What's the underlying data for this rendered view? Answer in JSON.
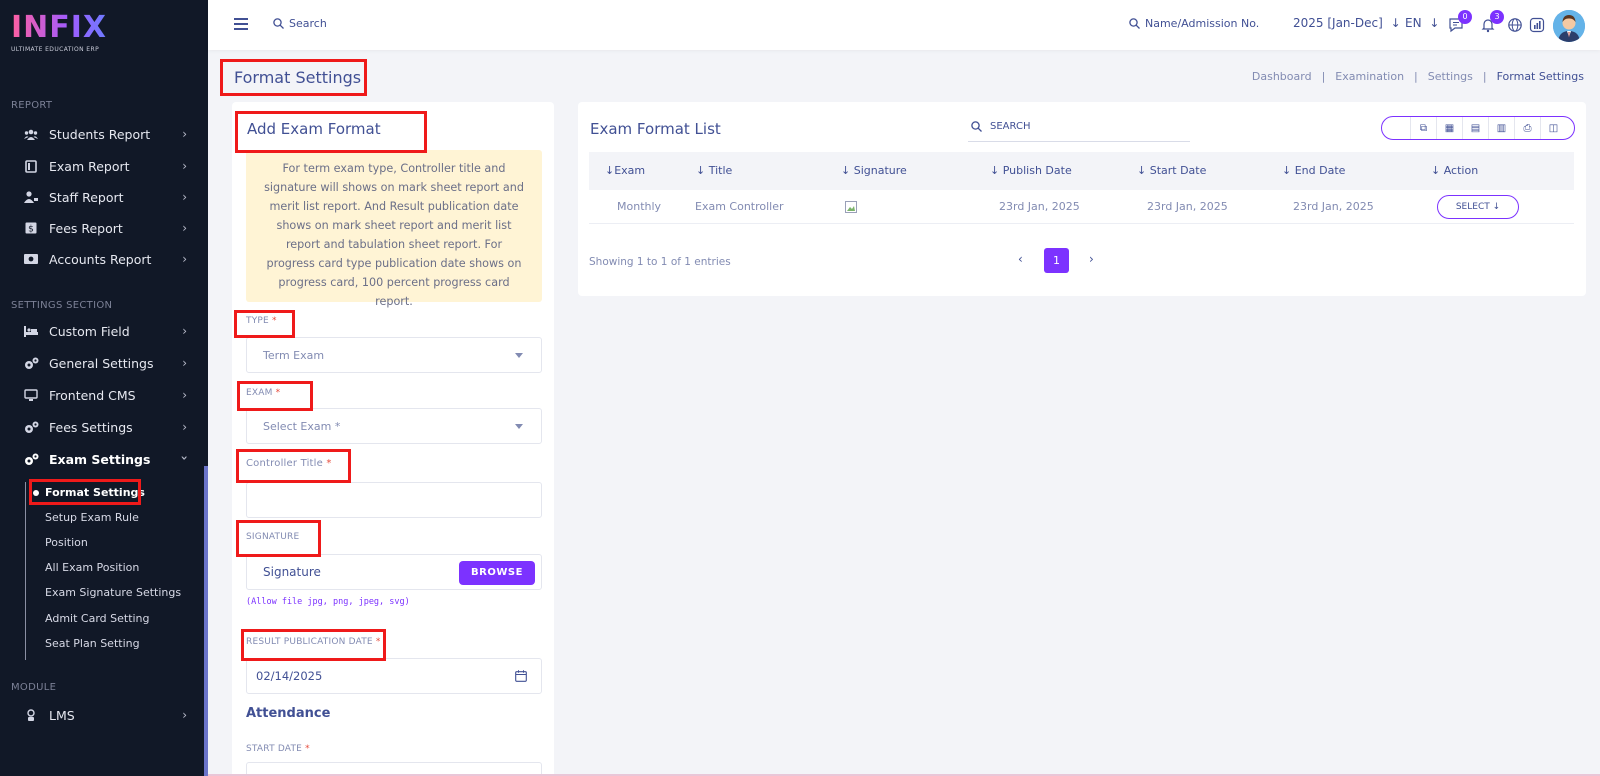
{
  "sidebar": {
    "logo": "INFIX",
    "logo_sub": "ULTIMATE EDUCATION ERP",
    "section_report": "REPORT",
    "report_items": [
      {
        "label": "Students Report",
        "icon": "users-icon"
      },
      {
        "label": "Exam Report",
        "icon": "book-icon"
      },
      {
        "label": "Staff Report",
        "icon": "staff-icon"
      },
      {
        "label": "Fees Report",
        "icon": "dollar-icon"
      },
      {
        "label": "Accounts Report",
        "icon": "money-icon"
      }
    ],
    "section_settings": "SETTINGS SECTION",
    "settings_items": [
      {
        "label": "Custom Field",
        "icon": "bed-icon"
      },
      {
        "label": "General Settings",
        "icon": "cogs-icon"
      },
      {
        "label": "Frontend CMS",
        "icon": "monitor-icon"
      },
      {
        "label": "Fees Settings",
        "icon": "cogs-icon"
      },
      {
        "label": "Exam Settings",
        "icon": "cogs-icon"
      }
    ],
    "exam_sub_items": [
      "Format Settings",
      "Setup Exam Rule",
      "Position",
      "All Exam Position",
      "Exam Signature Settings",
      "Admit Card Setting",
      "Seat Plan Setting"
    ],
    "section_module": "MODULE",
    "module_items": [
      {
        "label": "LMS",
        "icon": "lms-icon"
      }
    ]
  },
  "topbar": {
    "search_label": "Search",
    "name_search_label": "Name/Admission No.",
    "year_label": "2025 [Jan-Dec]",
    "lang_label": "EN",
    "messages_count": "0",
    "notifications_count": "3"
  },
  "breadcrumb": {
    "page_title": "Format Settings",
    "items": [
      "Dashboard",
      "Examination",
      "Settings",
      "Format Settings"
    ]
  },
  "form": {
    "title": "Add Exam Format",
    "notice": "For term exam type, Controller title and signature will shows on mark sheet report and merit list report. And Result publication date shows on mark sheet report and merit list report and tabulation sheet report. For progress card type publication date shows on progress card, 100 percent progress card report.",
    "type_label": "TYPE",
    "type_value": "Term Exam",
    "exam_label": "EXAM",
    "exam_value": "Select Exam *",
    "controller_label": "Controller Title",
    "controller_value": "",
    "signature_label": "SIGNATURE",
    "signature_placeholder": "Signature",
    "browse_label": "BROWSE",
    "file_hint": "(Allow file jpg, png, jpeg, svg)",
    "result_date_label": "RESULT PUBLICATION DATE",
    "result_date_value": "02/14/2025",
    "attendance_title": "Attendance",
    "start_date_label": "START DATE",
    "required_mark": "*"
  },
  "list": {
    "title": "Exam Format List",
    "search_label": "SEARCH",
    "columns": [
      "Exam",
      "Title",
      "Signature",
      "Publish Date",
      "Start Date",
      "End Date",
      "Action"
    ],
    "rows": [
      {
        "exam": "Monthly",
        "title": "Exam Controller",
        "publish_date": "23rd Jan, 2025",
        "start_date": "23rd Jan, 2025",
        "end_date": "23rd Jan, 2025",
        "action": "SELECT"
      }
    ],
    "showing_text": "Showing 1 to 1 of 1 entries",
    "current_page": "1"
  },
  "colors": {
    "accent": "#7c32ff",
    "sidebar_bg": "#111827",
    "text_primary": "#415094",
    "annotation": "#ef1a1a",
    "notice_bg": "#fff4d5"
  }
}
